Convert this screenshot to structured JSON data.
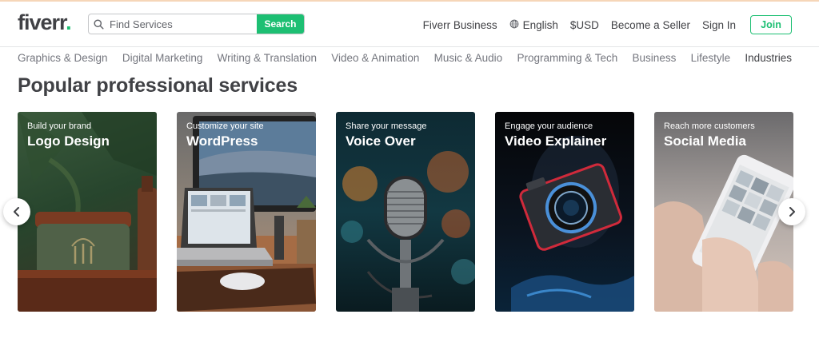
{
  "header": {
    "logo": "fiverr",
    "logo_dot": ".",
    "search_placeholder": "Find Services",
    "search_button": "Search",
    "nav": {
      "business": "Fiverr Business",
      "language": "English",
      "currency": "$USD",
      "become_seller": "Become a Seller",
      "sign_in": "Sign In",
      "join": "Join"
    }
  },
  "categories": [
    "Graphics & Design",
    "Digital Marketing",
    "Writing & Translation",
    "Video & Animation",
    "Music & Audio",
    "Programming & Tech",
    "Business",
    "Lifestyle",
    "Industries"
  ],
  "section": {
    "title": "Popular professional services"
  },
  "cards": [
    {
      "subtitle": "Build your brand",
      "title": "Logo Design"
    },
    {
      "subtitle": "Customize your site",
      "title": "WordPress"
    },
    {
      "subtitle": "Share your message",
      "title": "Voice Over"
    },
    {
      "subtitle": "Engage your audience",
      "title": "Video Explainer"
    },
    {
      "subtitle": "Reach more customers",
      "title": "Social Media"
    }
  ],
  "colors": {
    "brand_green": "#1dbf73",
    "text_dark": "#404145",
    "text_muted": "#74767e"
  },
  "icons": {
    "search": "magnifier-icon",
    "language": "globe-icon",
    "carousel_prev": "chevron-left-icon",
    "carousel_next": "chevron-right-icon"
  }
}
